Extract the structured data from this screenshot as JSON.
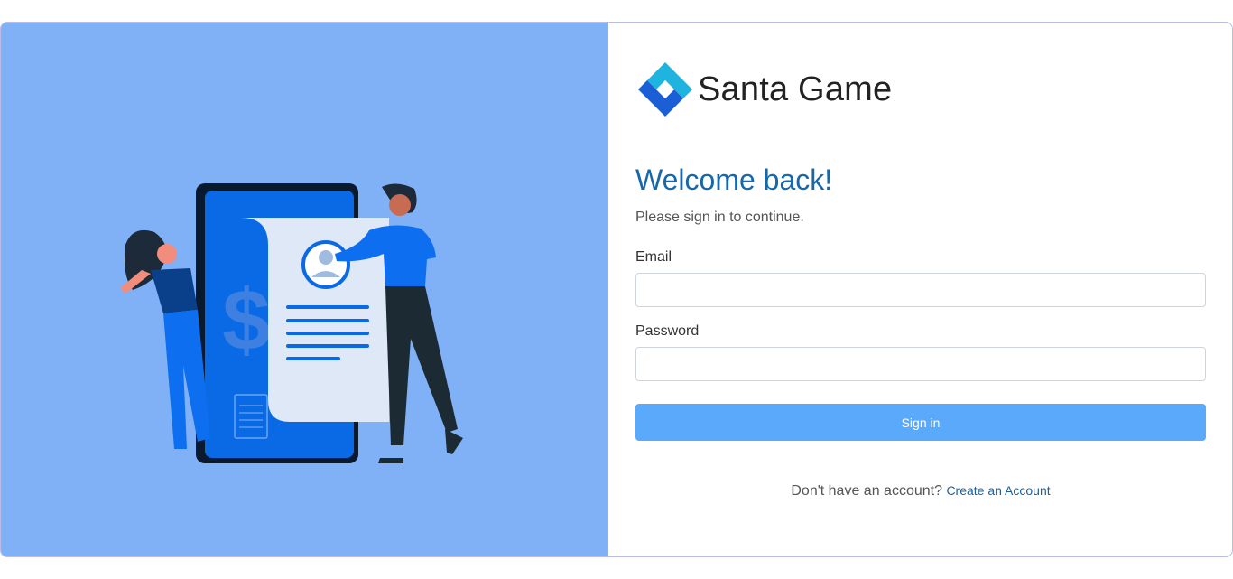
{
  "brand": {
    "name": "Santa Game",
    "logo_icon": "diamond-logo-icon",
    "colors": {
      "dark_blue": "#1a5fd6",
      "cyan": "#1fb3e0"
    }
  },
  "illustration": {
    "icon": "mobile-payment-illustration",
    "symbol": "$"
  },
  "form": {
    "heading": "Welcome back!",
    "subtitle": "Please sign in to continue.",
    "email_label": "Email",
    "email_value": "",
    "password_label": "Password",
    "password_value": "",
    "submit_label": "Sign in"
  },
  "footer": {
    "prompt": "Don't have an account?",
    "link_label": "Create an Account"
  },
  "colors": {
    "left_panel": "#80b1f7",
    "heading": "#1767ab",
    "button": "#5aa9fa",
    "link": "#1f5f97"
  }
}
